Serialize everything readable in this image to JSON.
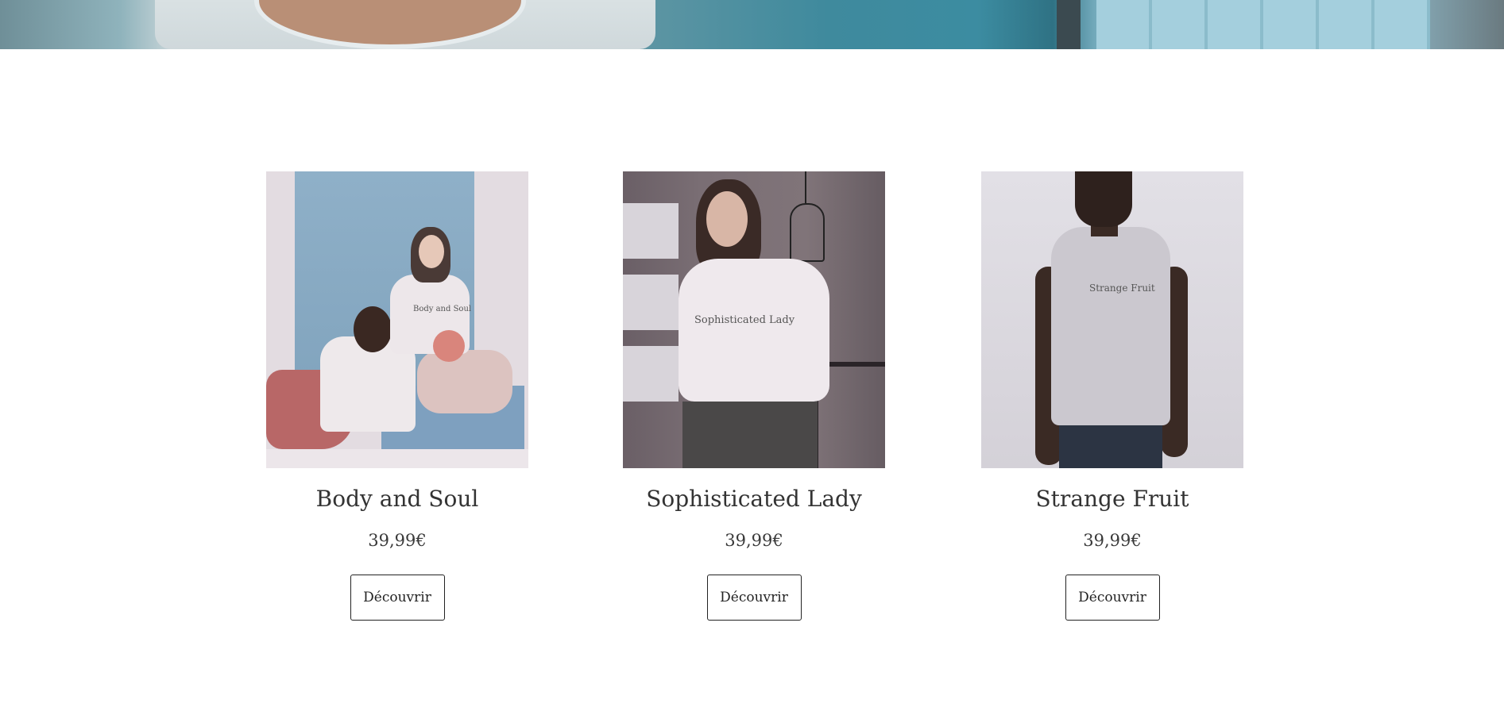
{
  "hero": {},
  "products": [
    {
      "title": "Body and Soul",
      "price": "39,99€",
      "button_label": "Découvrir",
      "tee_text": "Body and Soul"
    },
    {
      "title": "Sophisticated Lady",
      "price": "39,99€",
      "button_label": "Découvrir",
      "tee_text": "Sophisticated Lady"
    },
    {
      "title": "Strange Fruit",
      "price": "39,99€",
      "button_label": "Découvrir",
      "tee_text": "Strange Fruit"
    }
  ]
}
